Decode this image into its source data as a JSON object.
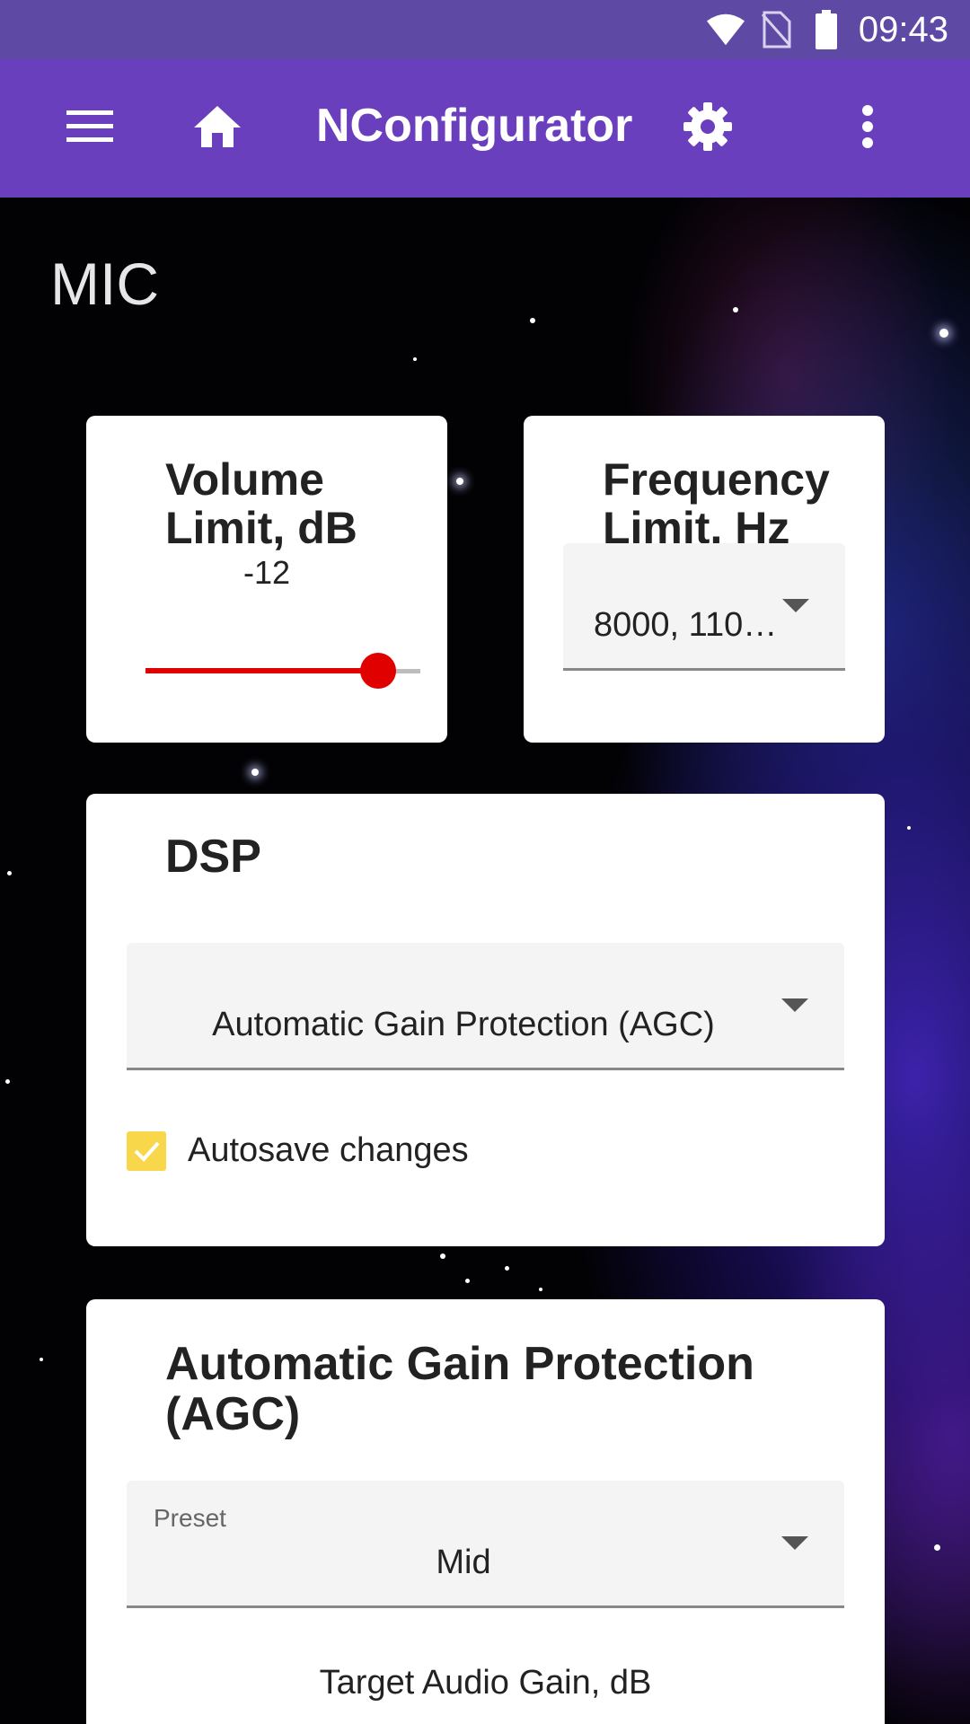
{
  "status_bar": {
    "time": "09:43",
    "icons": [
      "wifi-icon",
      "no-sim-icon",
      "battery-icon"
    ]
  },
  "app_bar": {
    "title": "NConfigurator",
    "icons": [
      "menu-icon",
      "home-icon",
      "settings-gear-icon",
      "more-vert-icon"
    ]
  },
  "section": {
    "title": "MIC"
  },
  "volume_card": {
    "title_line1": "Volume",
    "title_line2": "Limit, dB",
    "value": "-12",
    "slider_fraction": 0.9,
    "accent_color": "#e00000"
  },
  "frequency_card": {
    "title_line1": "Frequency",
    "title_line2": "Limit, Hz",
    "selected_value": "8000, 110…"
  },
  "dsp_card": {
    "title": "DSP",
    "selected_value": "Automatic Gain Protection (AGC)",
    "autosave_label": "Autosave changes",
    "autosave_checked": true,
    "checkbox_color": "#f8d84a"
  },
  "agc_card": {
    "title_line1": "Automatic Gain Protection",
    "title_line2": "(AGC)",
    "preset_label": "Preset",
    "preset_value": "Mid",
    "target_gain_label": "Target Audio Gain, dB"
  },
  "colors": {
    "status_bar": "#5e4aa5",
    "app_bar": "#6a3fbd"
  }
}
